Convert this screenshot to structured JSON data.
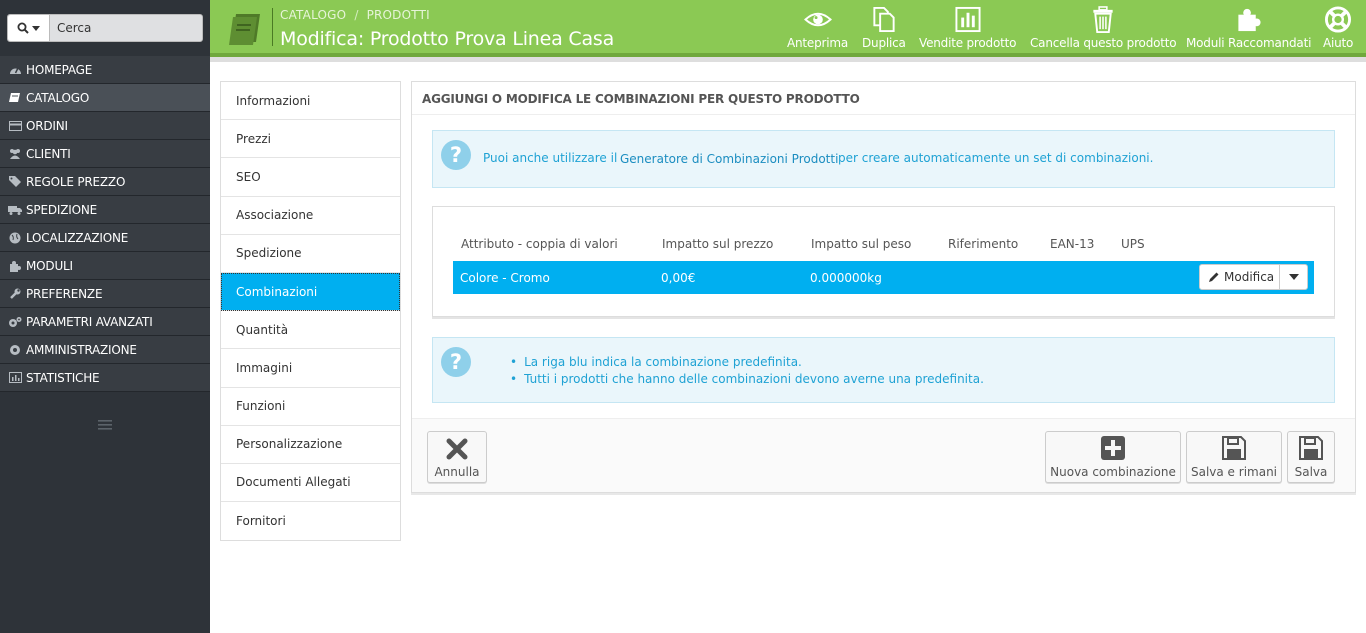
{
  "search": {
    "placeholder": "Cerca"
  },
  "sidebar": {
    "items": [
      {
        "label": "HOMEPAGE",
        "icon": "dashboard-icon"
      },
      {
        "label": "CATALOGO",
        "icon": "book-icon",
        "active": true
      },
      {
        "label": "ORDINI",
        "icon": "credit-card-icon"
      },
      {
        "label": "CLIENTI",
        "icon": "users-icon"
      },
      {
        "label": "REGOLE PREZZO",
        "icon": "tags-icon"
      },
      {
        "label": "SPEDIZIONE",
        "icon": "truck-icon"
      },
      {
        "label": "LOCALIZZAZIONE",
        "icon": "globe-icon"
      },
      {
        "label": "MODULI",
        "icon": "puzzle-icon"
      },
      {
        "label": "PREFERENZE",
        "icon": "wrench-icon"
      },
      {
        "label": "PARAMETRI AVANZATI",
        "icon": "cogs-icon"
      },
      {
        "label": "AMMINISTRAZIONE",
        "icon": "cog-icon"
      },
      {
        "label": "STATISTICHE",
        "icon": "bar-chart-icon"
      }
    ]
  },
  "header": {
    "breadcrumb": [
      "CATALOGO",
      "PRODOTTI"
    ],
    "breadcrumb_sep": "/",
    "title": "Modifica: Prodotto Prova Linea Casa",
    "accent_color": "#8bc954",
    "toolbar": {
      "preview": "Anteprima",
      "duplicate": "Duplica",
      "sales": "Vendite prodotto",
      "delete": "Cancella questo prodotto",
      "modules": "Moduli Raccomandati",
      "help": "Aiuto"
    }
  },
  "tabs": [
    {
      "label": "Informazioni"
    },
    {
      "label": "Prezzi"
    },
    {
      "label": "SEO"
    },
    {
      "label": "Associazione"
    },
    {
      "label": "Spedizione"
    },
    {
      "label": "Combinazioni",
      "active": true
    },
    {
      "label": "Quantità"
    },
    {
      "label": "Immagini"
    },
    {
      "label": "Funzioni"
    },
    {
      "label": "Personalizzazione"
    },
    {
      "label": "Documenti Allegati"
    },
    {
      "label": "Fornitori"
    }
  ],
  "panel": {
    "title": "AGGIUNGI O MODIFICA LE COMBINAZIONI PER QUESTO PRODOTTO",
    "hint": {
      "before": "Puoi anche utilizzare il",
      "link": "Generatore di Combinazioni Prodotti",
      "after": "per creare automaticamente un set di combinazioni."
    },
    "table": {
      "headers": [
        "Attributo - coppia di valori",
        "Impatto sul prezzo",
        "Impatto sul peso",
        "Riferimento",
        "EAN-13",
        "UPS"
      ],
      "rows": [
        {
          "attribute": "Colore - Cromo",
          "price_impact": "0,00€",
          "weight_impact": "0.000000kg",
          "reference": "",
          "ean13": "",
          "ups": "",
          "action": "Modifica"
        }
      ],
      "default_row_color": "#00aff0"
    },
    "notes": [
      "La riga blu indica la combinazione predefinita.",
      "Tutti i prodotti che hanno delle combinazioni devono averne una predefinita."
    ]
  },
  "footer": {
    "cancel": "Annulla",
    "new_combination": "Nuova combinazione",
    "save_and_stay": "Salva e rimani",
    "save": "Salva"
  }
}
